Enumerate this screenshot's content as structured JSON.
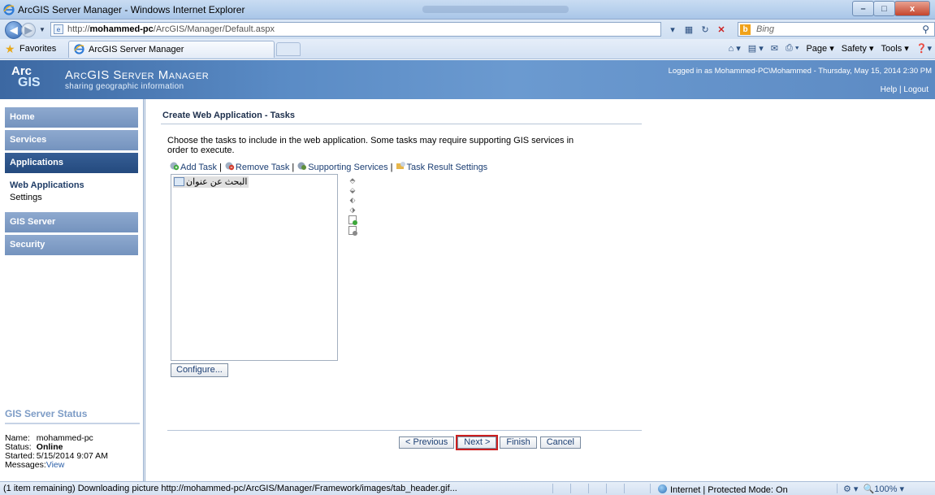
{
  "window": {
    "title": "ArcGIS Server Manager - Windows Internet Explorer",
    "minimize": "–",
    "maximize": "□",
    "close": "x"
  },
  "addressbar": {
    "url_prefix": "http://",
    "url_host": "mohammed-pc",
    "url_path": "/ArcGIS/Manager/Default.aspx",
    "search_placeholder": "Bing"
  },
  "favorites": {
    "label": "Favorites",
    "tab_label": "ArcGIS Server Manager"
  },
  "commandbar": {
    "page": "Page",
    "safety": "Safety",
    "tools": "Tools"
  },
  "banner": {
    "logo_top": "Arc",
    "logo_bottom": "GIS",
    "app_title": "ArcGIS Server Manager",
    "tagline": "sharing geographic information",
    "login_text": "Logged in as Mohammed-PC\\Mohammed - Thursday, May 15, 2014 2:30 PM",
    "help": "Help",
    "separator": "|",
    "logout": "Logout"
  },
  "nav": {
    "home": "Home",
    "services": "Services",
    "applications": "Applications",
    "web_applications": "Web Applications",
    "settings": "Settings",
    "gis_server": "GIS Server",
    "security": "Security"
  },
  "server_status": {
    "heading": "GIS Server Status",
    "name_label": "Name:",
    "name_value": "mohammed-pc",
    "status_label": "Status:",
    "status_value": "Online",
    "started_label": "Started:",
    "started_value": "5/15/2014 9:07 AM",
    "messages_label": "Messages:",
    "messages_link": "View"
  },
  "main": {
    "heading": "Create Web Application - Tasks",
    "description": "Choose the tasks to include in the web application. Some tasks may require supporting GIS services in order to execute.",
    "toolbar": {
      "add_task": "Add Task",
      "remove_task": "Remove Task",
      "supporting_services": "Supporting Services",
      "task_result_settings": "Task Result Settings",
      "separator": "|"
    },
    "tasks": [
      "البحث عن عنوان"
    ],
    "configure": "Configure...",
    "buttons": {
      "previous": "< Previous",
      "next": "Next >",
      "finish": "Finish",
      "cancel": "Cancel"
    }
  },
  "statusbar": {
    "message": "(1 item remaining) Downloading picture http://mohammed-pc/ArcGIS/Manager/Framework/images/tab_header.gif...",
    "zone": "Internet | Protected Mode: On",
    "zoom": "100%"
  },
  "colors": {
    "nav_active": "#2b5288",
    "nav_inactive": "#7f9dc7",
    "banner": "#4f7fbb",
    "highlight_box": "#cc1f1f"
  }
}
